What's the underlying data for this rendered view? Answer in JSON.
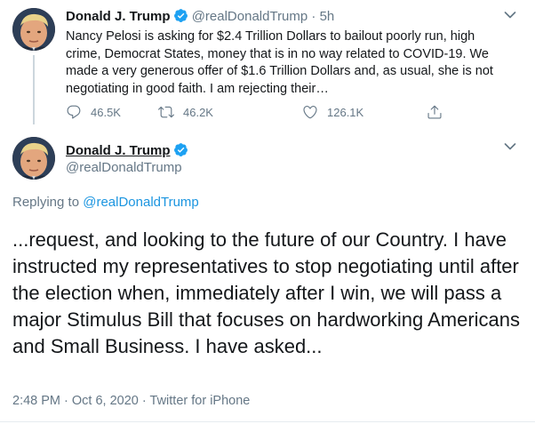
{
  "tweet1": {
    "author_name": "Donald J. Trump",
    "handle": "@realDonaldTrump",
    "separator": "·",
    "time_ago": "5h",
    "text": "Nancy Pelosi is asking for $2.4 Trillion Dollars to bailout poorly run, high crime, Democrat States, money that is in no way related to COVID-19. We made a very generous offer of $1.6 Trillion Dollars and, as usual, she is not negotiating in good faith. I am rejecting their…",
    "replies": "46.5K",
    "retweets": "46.2K",
    "likes": "126.1K"
  },
  "tweet2": {
    "author_name": "Donald J. Trump",
    "handle": "@realDonaldTrump",
    "replying_prefix": "Replying to",
    "replying_to": "@realDonaldTrump",
    "text": "...request, and looking to the future of our Country. I have instructed my representatives to stop negotiating until after the election when, immediately after I win, we will pass a major Stimulus Bill that focuses on hardworking Americans and Small Business. I have asked...",
    "time": "2:48 PM",
    "date": "Oct 6, 2020",
    "source": "Twitter for iPhone",
    "separator": "·"
  },
  "colors": {
    "text": "#14171a",
    "muted": "#657786",
    "link": "#1b95e0",
    "verified": "#1da1f2",
    "divider": "#e6ecf0"
  },
  "icons": [
    "verified-badge-icon",
    "chevron-down-icon",
    "reply-icon",
    "retweet-icon",
    "like-icon",
    "share-icon"
  ]
}
